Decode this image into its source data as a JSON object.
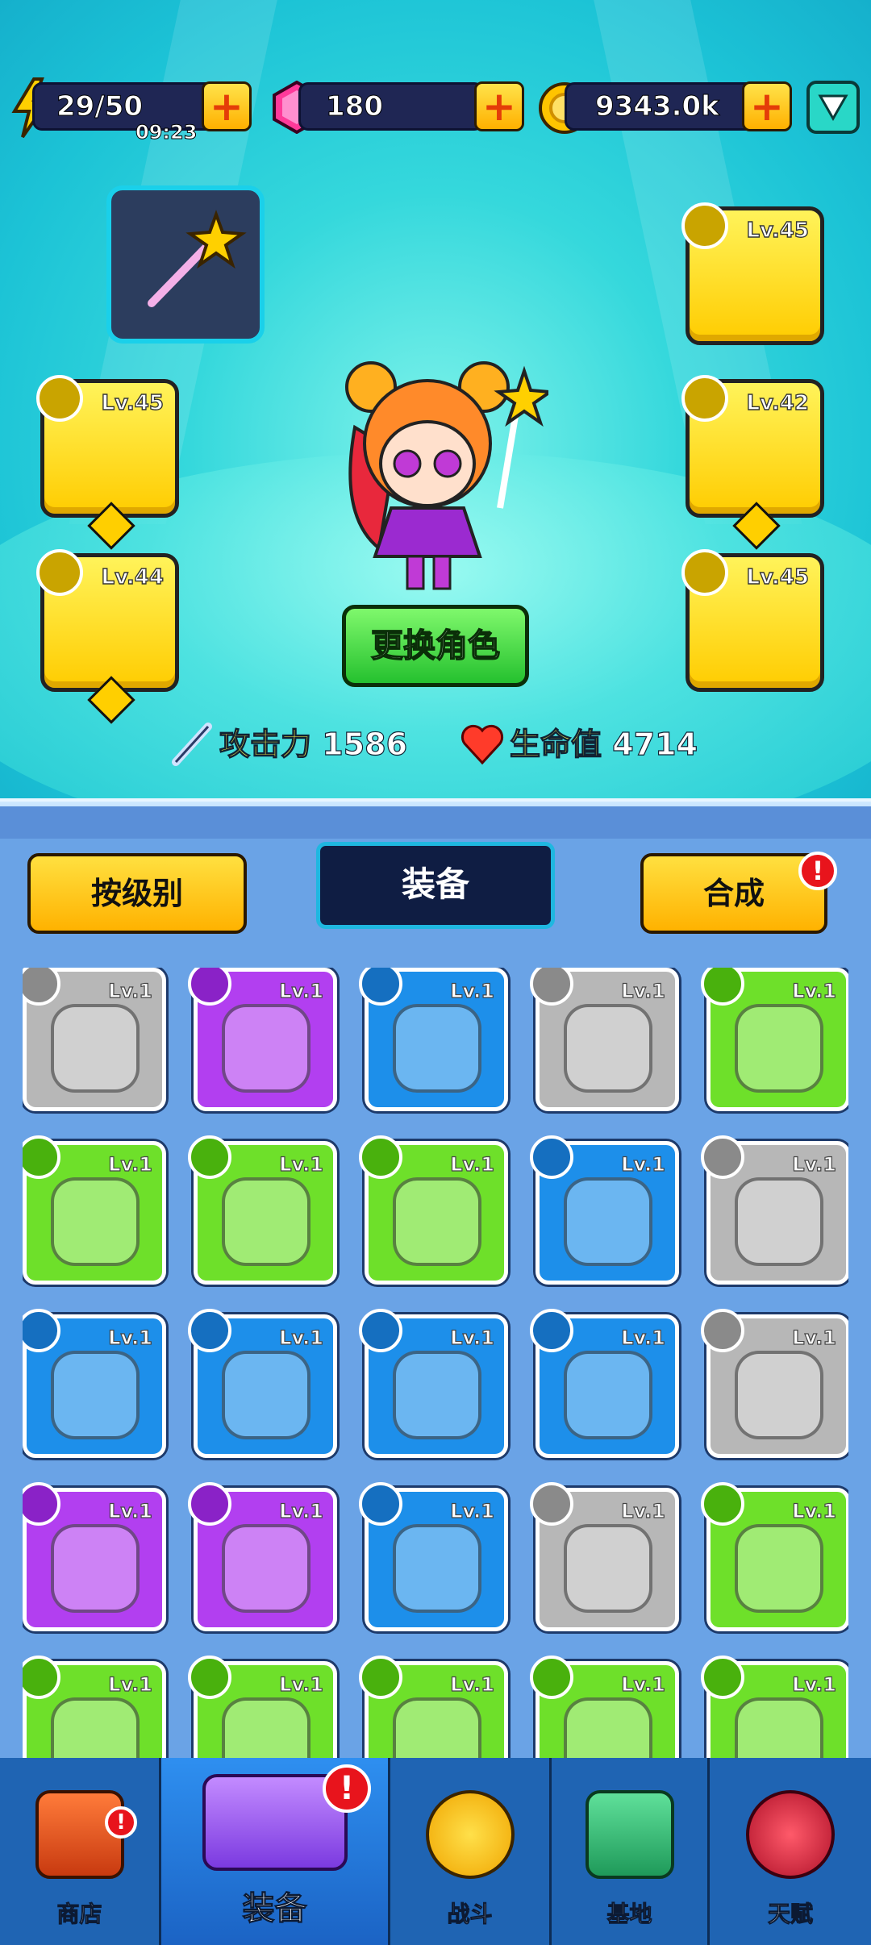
{
  "resources": {
    "energy": "29/50",
    "energy_timer": "09:23",
    "gems": "180",
    "coins": "9343.0k"
  },
  "equipment_slots": [
    {
      "level": "Lv.45",
      "type": "shirt-icon"
    },
    {
      "level": "Lv.45",
      "type": "scarf-icon"
    },
    {
      "level": "Lv.42",
      "type": "pants-icon"
    },
    {
      "level": "Lv.44",
      "type": "glove-icon"
    },
    {
      "level": "Lv.45",
      "type": "shoe-icon"
    }
  ],
  "actions": {
    "change_character": "更换角色"
  },
  "stats": {
    "attack_label": "攻击力",
    "attack_value": "1586",
    "hp_label": "生命值",
    "hp_value": "4714"
  },
  "panel": {
    "sort_button": "按级别",
    "title": "装备",
    "merge_button": "合成",
    "merge_alert": "!"
  },
  "items": [
    {
      "level": "Lv.1",
      "rarity": "gray",
      "type": "sock-icon"
    },
    {
      "level": "Lv.1",
      "rarity": "purple",
      "type": "sock-icon"
    },
    {
      "level": "Lv.1",
      "rarity": "blue",
      "type": "glove-icon"
    },
    {
      "level": "Lv.1",
      "rarity": "gray",
      "type": "shoe-icon"
    },
    {
      "level": "Lv.1",
      "rarity": "green",
      "type": "shirt-icon"
    },
    {
      "level": "Lv.1",
      "rarity": "green",
      "type": "shoe-icon"
    },
    {
      "level": "Lv.1",
      "rarity": "green",
      "type": "glove-icon"
    },
    {
      "level": "Lv.1",
      "rarity": "green",
      "type": "glove-icon"
    },
    {
      "level": "Lv.1",
      "rarity": "blue",
      "type": "necklace-icon"
    },
    {
      "level": "Lv.1",
      "rarity": "gray",
      "type": "scarf-icon"
    },
    {
      "level": "Lv.1",
      "rarity": "blue",
      "type": "shirt-icon"
    },
    {
      "level": "Lv.1",
      "rarity": "blue",
      "type": "armor-icon"
    },
    {
      "level": "Lv.1",
      "rarity": "blue",
      "type": "glove-icon"
    },
    {
      "level": "Lv.1",
      "rarity": "blue",
      "type": "glove-icon"
    },
    {
      "level": "Lv.1",
      "rarity": "gray",
      "type": "armor-icon"
    },
    {
      "level": "Lv.1",
      "rarity": "purple",
      "type": "pants-icon"
    },
    {
      "level": "Lv.1",
      "rarity": "purple",
      "type": "pants-icon"
    },
    {
      "level": "Lv.1",
      "rarity": "blue",
      "type": "necklace-icon"
    },
    {
      "level": "Lv.1",
      "rarity": "gray",
      "type": "pants-icon"
    },
    {
      "level": "Lv.1",
      "rarity": "green",
      "type": "shoe-icon"
    },
    {
      "level": "Lv.1",
      "rarity": "green",
      "type": "necklace-icon"
    },
    {
      "level": "Lv.1",
      "rarity": "green",
      "type": "scarf-icon"
    },
    {
      "level": "Lv.1",
      "rarity": "green",
      "type": "pants-icon"
    },
    {
      "level": "Lv.1",
      "rarity": "green",
      "type": "shirt-icon"
    },
    {
      "level": "Lv.1",
      "rarity": "green",
      "type": "shoe-icon"
    }
  ],
  "nav": {
    "shop": "商店",
    "equipment": "装备",
    "battle": "战斗",
    "base": "基地",
    "talent": "天赋",
    "alert": "!"
  },
  "colors": {
    "rarity_gray": "#b7b7b7",
    "rarity_purple": "#b23ff0",
    "rarity_blue": "#1d8fea",
    "rarity_green": "#6ee02a",
    "slot_gold": "#ffcc00"
  }
}
